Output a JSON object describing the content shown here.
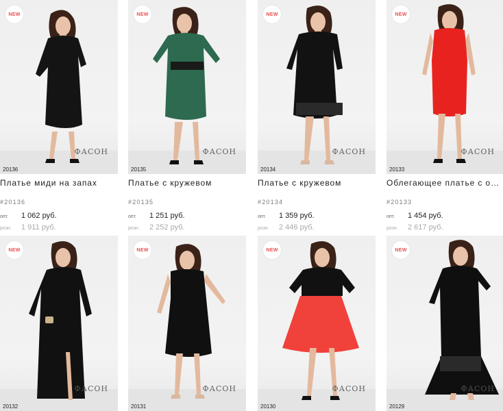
{
  "products": [
    {
      "badge": "NEW",
      "code": "20136",
      "brand": "ФАСОН",
      "name": "Платье миди на запах",
      "sku": "#20136",
      "opt_label": "опт.",
      "opt_price": "1 062 руб.",
      "retail_label": "розн.",
      "retail_price": "1 911 руб.",
      "dress_color": "#141414"
    },
    {
      "badge": "NEW",
      "code": "20135",
      "brand": "ФАСОН",
      "name": "Платье с кружевом",
      "sku": "#20135",
      "opt_label": "опт.",
      "opt_price": "1 251 руб.",
      "retail_label": "розн.",
      "retail_price": "2 252 руб.",
      "dress_color": "#2d6a4f"
    },
    {
      "badge": "NEW",
      "code": "20134",
      "brand": "ФАСОН",
      "name": "Платье с кружевом",
      "sku": "#20134",
      "opt_label": "опт.",
      "opt_price": "1 359 руб.",
      "retail_label": "розн.",
      "retail_price": "2 446 руб.",
      "dress_color": "#121212"
    },
    {
      "badge": "NEW",
      "code": "20133",
      "brand": "ФАСОН",
      "name": "Облегающее платье с об…",
      "sku": "#20133",
      "opt_label": "опт.",
      "opt_price": "1 454 руб.",
      "retail_label": "розн.",
      "retail_price": "2 617 руб.",
      "dress_color": "#e8231f"
    },
    {
      "badge": "NEW",
      "code": "20132",
      "brand": "ФАСОН",
      "dress_color": "#111111"
    },
    {
      "badge": "NEW",
      "code": "20131",
      "brand": "ФАСОН",
      "dress_color": "#101010"
    },
    {
      "badge": "NEW",
      "code": "20130",
      "brand": "ФАСОН",
      "dress_color": "#f0413b"
    },
    {
      "badge": "NEW",
      "code": "20129",
      "brand": "ФАСОН",
      "dress_color": "#0f0f0f"
    }
  ]
}
